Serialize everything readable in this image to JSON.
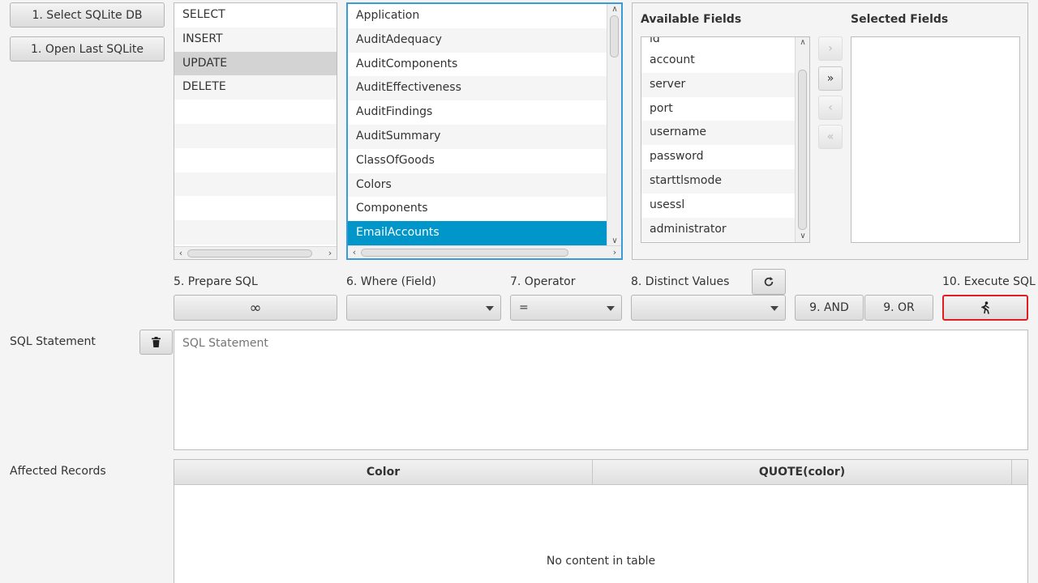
{
  "buttons": {
    "select_db": "1. Select SQLite DB",
    "open_last": "1. Open Last SQLite",
    "prepare_sql_icon": "∞",
    "and": "9. AND",
    "or": "9. OR",
    "move_right": "›",
    "move_all_right": "»",
    "move_left": "‹",
    "move_all_left": "«"
  },
  "statements": {
    "items": [
      {
        "label": "SELECT"
      },
      {
        "label": "INSERT"
      },
      {
        "label": "UPDATE"
      },
      {
        "label": "DELETE"
      }
    ],
    "selected": "UPDATE"
  },
  "tables": {
    "items": [
      {
        "label": "Application"
      },
      {
        "label": "AuditAdequacy"
      },
      {
        "label": "AuditComponents"
      },
      {
        "label": "AuditEffectiveness"
      },
      {
        "label": "AuditFindings"
      },
      {
        "label": "AuditSummary"
      },
      {
        "label": "ClassOfGoods"
      },
      {
        "label": "Colors"
      },
      {
        "label": "Components"
      },
      {
        "label": "EmailAccounts"
      }
    ],
    "selected": "EmailAccounts"
  },
  "fields": {
    "available_title": "Available Fields",
    "selected_title": "Selected Fields",
    "partial_top": "id",
    "available": [
      {
        "label": "account"
      },
      {
        "label": "server"
      },
      {
        "label": "port"
      },
      {
        "label": "username"
      },
      {
        "label": "password"
      },
      {
        "label": "starttlsmode"
      },
      {
        "label": "usessl"
      },
      {
        "label": "administrator"
      }
    ]
  },
  "steps": {
    "prepare": "5. Prepare SQL",
    "where": "6. Where (Field)",
    "operator": "7. Operator",
    "distinct": "8. Distinct Values",
    "execute": "10. Execute SQL"
  },
  "operator_value": "=",
  "sql": {
    "label": "SQL Statement",
    "placeholder": "SQL Statement"
  },
  "affected": {
    "label": "Affected Records",
    "columns": [
      "Color",
      "QUOTE(color)"
    ],
    "empty_text": "No content in table"
  },
  "icons": {
    "trash": "trash-icon",
    "refresh": "refresh-icon",
    "run": "run-icon"
  },
  "colors": {
    "selection_blue": "#0096c9",
    "execute_border": "#e02020"
  }
}
